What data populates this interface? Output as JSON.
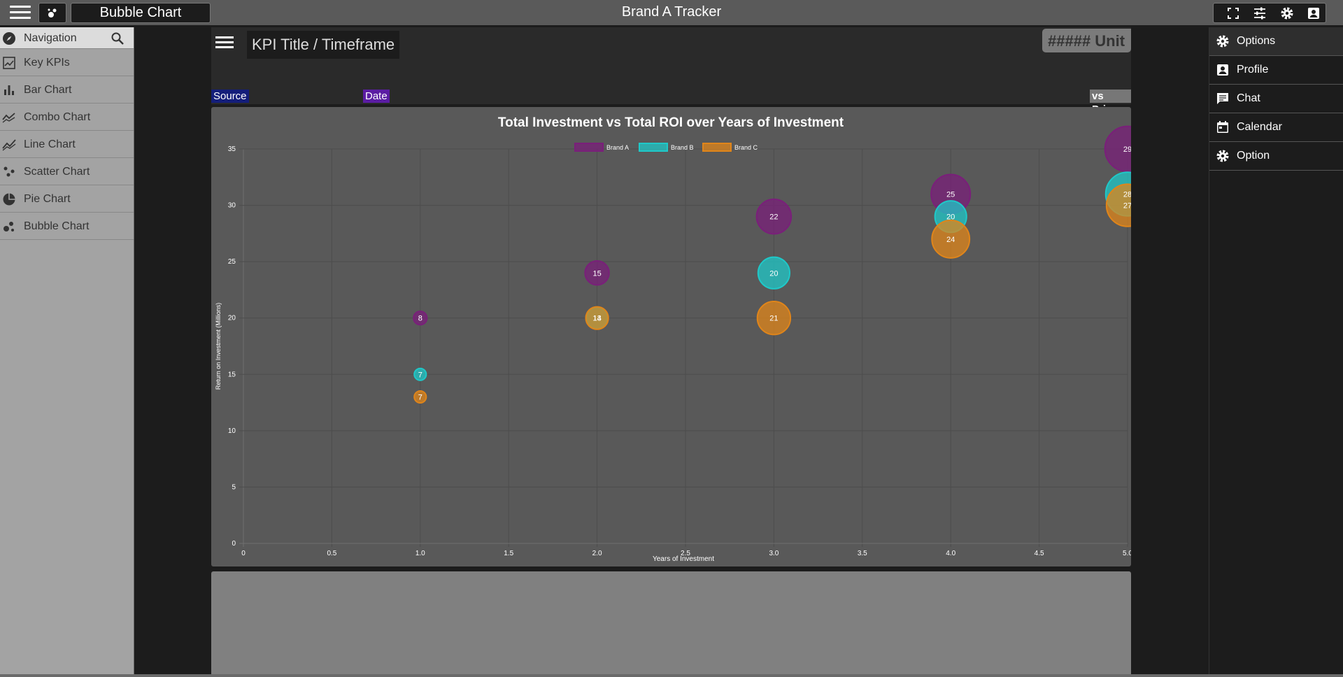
{
  "app": {
    "title": "Brand A Tracker",
    "page_name": "Bubble Chart"
  },
  "toolbar": {
    "icons": [
      "fullscreen-icon",
      "sliders-icon",
      "gear-icon",
      "profile-icon"
    ]
  },
  "left_nav": {
    "header": "Navigation",
    "items": [
      {
        "label": "Key KPIs",
        "icon": "kpi-icon"
      },
      {
        "label": "Bar Chart",
        "icon": "bar-chart-icon"
      },
      {
        "label": "Combo Chart",
        "icon": "combo-chart-icon"
      },
      {
        "label": "Line Chart",
        "icon": "line-chart-icon"
      },
      {
        "label": "Scatter Chart",
        "icon": "scatter-chart-icon"
      },
      {
        "label": "Pie Chart",
        "icon": "pie-chart-icon"
      },
      {
        "label": "Bubble Chart",
        "icon": "bubble-chart-icon"
      }
    ]
  },
  "kpi": {
    "title": "KPI Title / Timeframe",
    "unit": "##### Unit",
    "source_label": "Source",
    "date_label": "Date",
    "prior_label": "vs Prior"
  },
  "right_nav": {
    "items": [
      {
        "label": "Options",
        "icon": "gear-icon"
      },
      {
        "label": "Profile",
        "icon": "profile-icon"
      },
      {
        "label": "Chat",
        "icon": "chat-icon"
      },
      {
        "label": "Calendar",
        "icon": "calendar-icon"
      },
      {
        "label": "Option",
        "icon": "gear-icon"
      }
    ]
  },
  "colors": {
    "brand_a": "#7a1f7a",
    "brand_b": "#1fc8c8",
    "brand_c": "#e0851a"
  },
  "chart_data": {
    "type": "bubble",
    "title": "Total Investment vs Total ROI over Years of Investment",
    "xlabel": "Years of Investment",
    "ylabel": "Return on Investment (Millions)",
    "xlim": [
      0,
      5
    ],
    "ylim": [
      0,
      35
    ],
    "x_ticks": [
      "0",
      "0.5",
      "1.0",
      "1.5",
      "2.0",
      "2.5",
      "3.0",
      "3.5",
      "4.0",
      "4.5",
      "5.0"
    ],
    "y_ticks": [
      "0",
      "5",
      "10",
      "15",
      "20",
      "25",
      "30",
      "35"
    ],
    "grid": true,
    "legend_position": "top",
    "series": [
      {
        "name": "Brand A",
        "color": "#7a1f7a",
        "points": [
          {
            "x": 1,
            "y": 20,
            "r": 8
          },
          {
            "x": 2,
            "y": 24,
            "r": 15
          },
          {
            "x": 3,
            "y": 29,
            "r": 22
          },
          {
            "x": 4,
            "y": 31,
            "r": 25
          },
          {
            "x": 5,
            "y": 35,
            "r": 29
          }
        ]
      },
      {
        "name": "Brand B",
        "color": "#1fc8c8",
        "points": [
          {
            "x": 1,
            "y": 15,
            "r": 7
          },
          {
            "x": 2,
            "y": 20,
            "r": 13
          },
          {
            "x": 3,
            "y": 24,
            "r": 20
          },
          {
            "x": 4,
            "y": 29,
            "r": 20
          },
          {
            "x": 5,
            "y": 31,
            "r": 28
          }
        ]
      },
      {
        "name": "Brand C",
        "color": "#e0851a",
        "points": [
          {
            "x": 1,
            "y": 13,
            "r": 7
          },
          {
            "x": 2,
            "y": 20,
            "r": 14
          },
          {
            "x": 3,
            "y": 20,
            "r": 21
          },
          {
            "x": 4,
            "y": 27,
            "r": 24
          },
          {
            "x": 5,
            "y": 30,
            "r": 27
          }
        ]
      }
    ]
  }
}
